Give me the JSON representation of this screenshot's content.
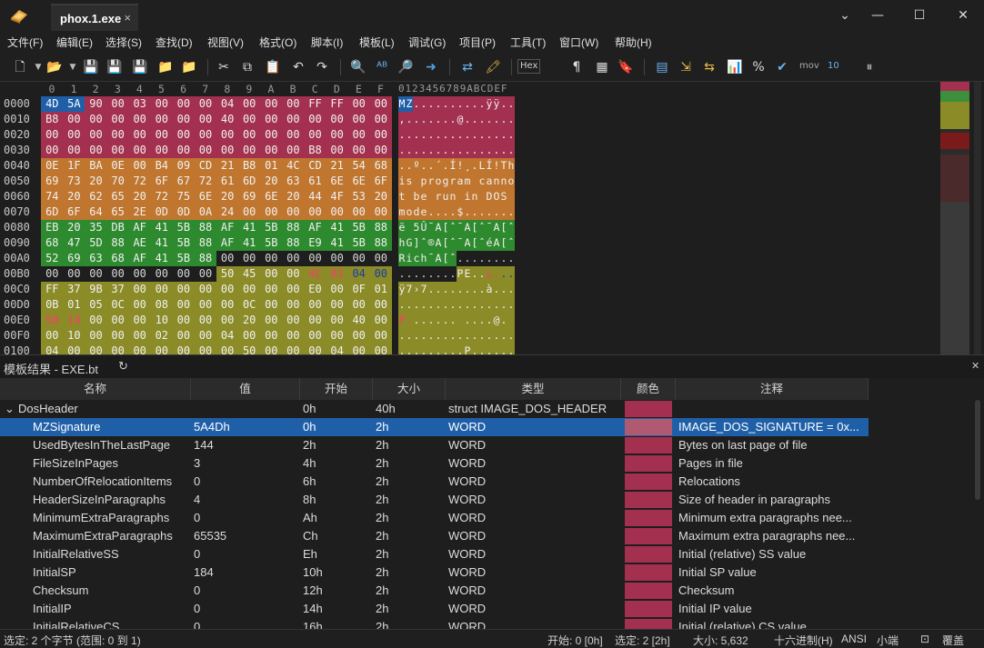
{
  "tab": {
    "title": "phox.1.exe",
    "close": "×"
  },
  "window_buttons": {
    "dropdown": "⌄",
    "minimize": "—",
    "maximize": "☐",
    "close": "✕"
  },
  "menu": [
    "文件(F)",
    "编辑(E)",
    "选择(S)",
    "查找(D)",
    "视图(V)",
    "格式(O)",
    "脚本(I)",
    "模板(L)",
    "调试(G)",
    "项目(P)",
    "工具(T)",
    "窗口(W)",
    "帮助(H)"
  ],
  "toolbar": {
    "hex_label": "Hex",
    "mov_label": "mov",
    "bits_label": "10"
  },
  "hex": {
    "columns": [
      "0",
      "1",
      "2",
      "3",
      "4",
      "5",
      "6",
      "7",
      "8",
      "9",
      "A",
      "B",
      "C",
      "D",
      "E",
      "F"
    ],
    "ascii_header": "0123456789ABCDEF",
    "rows": [
      {
        "addr": "0000",
        "bytes": [
          "4D",
          "5A",
          "90",
          "00",
          "03",
          "00",
          "00",
          "00",
          "04",
          "00",
          "00",
          "00",
          "FF",
          "FF",
          "00",
          "00"
        ],
        "ascii": "MZ..........ÿÿ.."
      },
      {
        "addr": "0010",
        "bytes": [
          "B8",
          "00",
          "00",
          "00",
          "00",
          "00",
          "00",
          "00",
          "40",
          "00",
          "00",
          "00",
          "00",
          "00",
          "00",
          "00"
        ],
        "ascii": ",.......@......."
      },
      {
        "addr": "0020",
        "bytes": [
          "00",
          "00",
          "00",
          "00",
          "00",
          "00",
          "00",
          "00",
          "00",
          "00",
          "00",
          "00",
          "00",
          "00",
          "00",
          "00"
        ],
        "ascii": "................"
      },
      {
        "addr": "0030",
        "bytes": [
          "00",
          "00",
          "00",
          "00",
          "00",
          "00",
          "00",
          "00",
          "00",
          "00",
          "00",
          "00",
          "B8",
          "00",
          "00",
          "00"
        ],
        "ascii": "................"
      },
      {
        "addr": "0040",
        "bytes": [
          "0E",
          "1F",
          "BA",
          "0E",
          "00",
          "B4",
          "09",
          "CD",
          "21",
          "B8",
          "01",
          "4C",
          "CD",
          "21",
          "54",
          "68"
        ],
        "ascii": "..º..´.Í!¸.LÍ!Th"
      },
      {
        "addr": "0050",
        "bytes": [
          "69",
          "73",
          "20",
          "70",
          "72",
          "6F",
          "67",
          "72",
          "61",
          "6D",
          "20",
          "63",
          "61",
          "6E",
          "6E",
          "6F"
        ],
        "ascii": "is program canno"
      },
      {
        "addr": "0060",
        "bytes": [
          "74",
          "20",
          "62",
          "65",
          "20",
          "72",
          "75",
          "6E",
          "20",
          "69",
          "6E",
          "20",
          "44",
          "4F",
          "53",
          "20"
        ],
        "ascii": "t be run in DOS "
      },
      {
        "addr": "0070",
        "bytes": [
          "6D",
          "6F",
          "64",
          "65",
          "2E",
          "0D",
          "0D",
          "0A",
          "24",
          "00",
          "00",
          "00",
          "00",
          "00",
          "00",
          "00"
        ],
        "ascii": "mode....$......."
      },
      {
        "addr": "0080",
        "bytes": [
          "EB",
          "20",
          "35",
          "DB",
          "AF",
          "41",
          "5B",
          "88",
          "AF",
          "41",
          "5B",
          "88",
          "AF",
          "41",
          "5B",
          "88"
        ],
        "ascii": "ë 5Û¯A[ˆ¯A[ˆ¯A[ˆ"
      },
      {
        "addr": "0090",
        "bytes": [
          "68",
          "47",
          "5D",
          "88",
          "AE",
          "41",
          "5B",
          "88",
          "AF",
          "41",
          "5B",
          "88",
          "E9",
          "41",
          "5B",
          "88"
        ],
        "ascii": "hG]ˆ®A[ˆ¯A[ˆéA[ˆ"
      },
      {
        "addr": "00A0",
        "bytes": [
          "52",
          "69",
          "63",
          "68",
          "AF",
          "41",
          "5B",
          "88",
          "00",
          "00",
          "00",
          "00",
          "00",
          "00",
          "00",
          "00"
        ],
        "ascii": "Rich¯A[ˆ........"
      },
      {
        "addr": "00B0",
        "bytes": [
          "00",
          "00",
          "00",
          "00",
          "00",
          "00",
          "00",
          "00",
          "50",
          "45",
          "00",
          "00",
          "4C",
          "01",
          "04",
          "00"
        ],
        "ascii": "........PE..L..."
      },
      {
        "addr": "00C0",
        "bytes": [
          "FF",
          "37",
          "9B",
          "37",
          "00",
          "00",
          "00",
          "00",
          "00",
          "00",
          "00",
          "00",
          "E0",
          "00",
          "0F",
          "01"
        ],
        "ascii": "ÿ7›7........à..."
      },
      {
        "addr": "00D0",
        "bytes": [
          "0B",
          "01",
          "05",
          "0C",
          "00",
          "08",
          "00",
          "00",
          "00",
          "0C",
          "00",
          "00",
          "00",
          "00",
          "00",
          "00"
        ],
        "ascii": "................"
      },
      {
        "addr": "00E0",
        "bytes": [
          "50",
          "14",
          "00",
          "00",
          "00",
          "10",
          "00",
          "00",
          "00",
          "20",
          "00",
          "00",
          "00",
          "00",
          "40",
          "00"
        ],
        "ascii": "P....... ....@."
      },
      {
        "addr": "00F0",
        "bytes": [
          "00",
          "10",
          "00",
          "00",
          "00",
          "02",
          "00",
          "00",
          "04",
          "00",
          "00",
          "00",
          "00",
          "00",
          "00",
          "00"
        ],
        "ascii": "................"
      },
      {
        "addr": "0100",
        "bytes": [
          "04",
          "00",
          "00",
          "00",
          "00",
          "00",
          "00",
          "00",
          "00",
          "50",
          "00",
          "00",
          "00",
          "04",
          "00",
          "00"
        ],
        "ascii": ".........P......"
      }
    ]
  },
  "panel": {
    "title": "模板结果 - EXE.bt",
    "refresh": "↻",
    "close": "✕"
  },
  "table": {
    "headers": [
      "名称",
      "值",
      "开始",
      "大小",
      "类型",
      "颜色",
      "注释"
    ],
    "rows": [
      {
        "name": "DosHeader",
        "value": "",
        "start": "0h",
        "size": "40h",
        "type": "struct IMAGE_DOS_HEADER",
        "comment": ""
      },
      {
        "name": "MZSignature",
        "value": "5A4Dh",
        "start": "0h",
        "size": "2h",
        "type": "WORD",
        "comment": "IMAGE_DOS_SIGNATURE = 0x..."
      },
      {
        "name": "UsedBytesInTheLastPage",
        "value": "144",
        "start": "2h",
        "size": "2h",
        "type": "WORD",
        "comment": "Bytes on last page of file"
      },
      {
        "name": "FileSizeInPages",
        "value": "3",
        "start": "4h",
        "size": "2h",
        "type": "WORD",
        "comment": "Pages in file"
      },
      {
        "name": "NumberOfRelocationItems",
        "value": "0",
        "start": "6h",
        "size": "2h",
        "type": "WORD",
        "comment": "Relocations"
      },
      {
        "name": "HeaderSizeInParagraphs",
        "value": "4",
        "start": "8h",
        "size": "2h",
        "type": "WORD",
        "comment": "Size of header in paragraphs"
      },
      {
        "name": "MinimumExtraParagraphs",
        "value": "0",
        "start": "Ah",
        "size": "2h",
        "type": "WORD",
        "comment": "Minimum extra paragraphs nee..."
      },
      {
        "name": "MaximumExtraParagraphs",
        "value": "65535",
        "start": "Ch",
        "size": "2h",
        "type": "WORD",
        "comment": "Maximum extra paragraphs nee..."
      },
      {
        "name": "InitialRelativeSS",
        "value": "0",
        "start": "Eh",
        "size": "2h",
        "type": "WORD",
        "comment": "Initial (relative) SS value"
      },
      {
        "name": "InitialSP",
        "value": "184",
        "start": "10h",
        "size": "2h",
        "type": "WORD",
        "comment": "Initial SP value"
      },
      {
        "name": "Checksum",
        "value": "0",
        "start": "12h",
        "size": "2h",
        "type": "WORD",
        "comment": "Checksum"
      },
      {
        "name": "InitialIP",
        "value": "0",
        "start": "14h",
        "size": "2h",
        "type": "WORD",
        "comment": "Initial IP value"
      },
      {
        "name": "InitialRelativeCS",
        "value": "0",
        "start": "16h",
        "size": "2h",
        "type": "WORD",
        "comment": "Initial (relative) CS value"
      }
    ]
  },
  "status": {
    "selection": "选定: 2 个字节 (范围: 0 到 1)",
    "start": "开始: 0 [0h]",
    "selected": "选定: 2 [2h]",
    "size": "大小: 5,632",
    "base": "十六进制(H)",
    "encoding": "ANSI",
    "endian": "小端",
    "mode": "覆盖"
  },
  "colors": {
    "dos_header": "#a3304f",
    "dos_stub": "#c0762e",
    "rich": "#2e8a2e",
    "pe": "#8b8b28",
    "selection": "#1f5fa8"
  }
}
